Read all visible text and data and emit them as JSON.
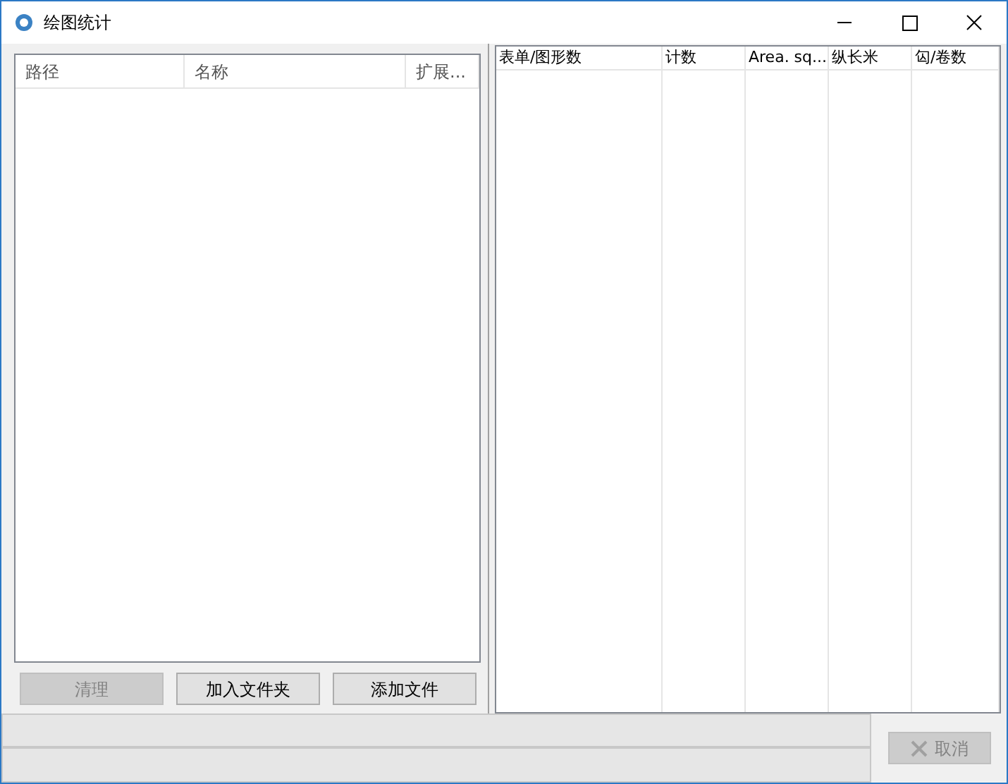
{
  "window": {
    "title": "绘图统计"
  },
  "file_list": {
    "columns": [
      "路径",
      "名称",
      "扩展..."
    ]
  },
  "file_buttons": [
    {
      "label": "清理",
      "disabled": true
    },
    {
      "label": "加入文件夹",
      "disabled": false
    },
    {
      "label": "添加文件",
      "disabled": false
    }
  ],
  "stats_table": {
    "columns": [
      "表单/图形数",
      "计数",
      "Area. sq....",
      "纵长米",
      "匃/卷数"
    ]
  },
  "cancel_button": {
    "label": "取消",
    "disabled": true
  }
}
